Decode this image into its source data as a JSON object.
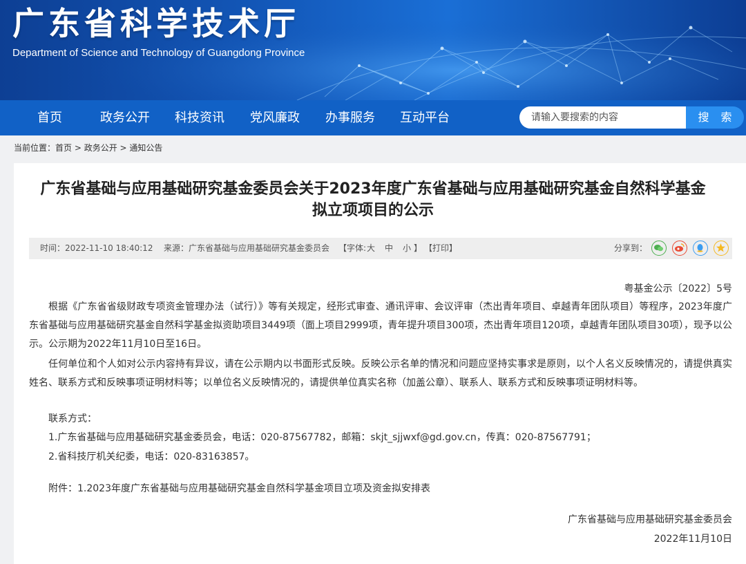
{
  "header": {
    "site_title": "广东省科学技术厅",
    "site_subtitle": "Department of Science and Technology of Guangdong Province"
  },
  "nav": {
    "items": [
      {
        "label": "首页"
      },
      {
        "label": "政务公开"
      },
      {
        "label": "科技资讯"
      },
      {
        "label": "党风廉政"
      },
      {
        "label": "办事服务"
      },
      {
        "label": "互动平台"
      }
    ],
    "search_placeholder": "请输入要搜索的内容",
    "search_button": "搜 索"
  },
  "breadcrumb": {
    "prefix": "当前位置：",
    "items": [
      "首页",
      "政务公开",
      "通知公告"
    ],
    "separator": " > "
  },
  "article": {
    "title_line1": "广东省基础与应用基础研究基金委员会关于2023年度广东省基础与应用基础研究基金自然科学基金",
    "title_line2": "拟立项项目的公示",
    "meta": {
      "time": "时间：2022-11-10 18:40:12",
      "source": "来源：广东省基础与应用基础研究基金委员会",
      "font_label": "【字体:",
      "font_large": "大",
      "font_medium": "中",
      "font_small": "小",
      "font_close": "】",
      "print": "【打印】",
      "share_label": "分享到："
    },
    "share_icons": [
      "wechat-icon",
      "weibo-icon",
      "qq-icon",
      "qzone-icon"
    ],
    "doc_number": "粤基金公示〔2022〕5号",
    "paragraph1": "根据《广东省省级财政专项资金管理办法（试行）》等有关规定，经形式审查、通讯评审、会议评审（杰出青年项目、卓越青年团队项目）等程序，2023年度广东省基础与应用基础研究基金自然科学基金拟资助项目3449项（面上项目2999项，青年提升项目300项，杰出青年项目120项，卓越青年团队项目30项），现予以公示。公示期为2022年11月10日至16日。",
    "paragraph2": "任何单位和个人如对公示内容持有异议，请在公示期内以书面形式反映。反映公示名单的情况和问题应坚持实事求是原则，以个人名义反映情况的，请提供真实姓名、联系方式和反映事项证明材料等；以单位名义反映情况的，请提供单位真实名称（加盖公章）、联系人、联系方式和反映事项证明材料等。",
    "contact_title": "联系方式：",
    "contact1": "1.广东省基础与应用基础研究基金委员会，电话：020-87567782，邮箱：skjt_sjjwxf@gd.gov.cn，传真：020-87567791；",
    "contact2": "2.省科技厅机关纪委，电话：020-83163857。",
    "attachment_label": "附件：",
    "attachment": "1.2023年度广东省基础与应用基础研究基金自然科学基金项目立项及资金拟安排表",
    "signature": "广东省基础与应用基础研究基金委员会",
    "date": "2022年11月10日"
  },
  "colors": {
    "banner": "#1357b8",
    "navbar": "#1161c6",
    "search_button": "#2a8ff0",
    "meta_bar": "#eeeeee",
    "wechat": "#4caf50",
    "weibo": "#e94b35",
    "qq": "#3a9cf0",
    "qzone": "#f5b820"
  }
}
